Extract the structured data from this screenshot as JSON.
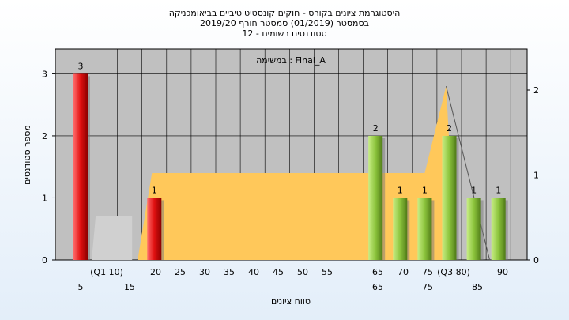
{
  "chart_data": {
    "type": "bar",
    "title": "היסטוגרמת ציונים בקורס - חוקים קונסטיטוטיביים בביאומכניקה",
    "subtitle_1": "בסמסטר (01/2019) סמסטר חורף 2019/20",
    "subtitle_2": "סטודנטים רשומים - 12",
    "inner_label": "במשימה : Final_A",
    "xlabel": "טווח ציונים",
    "ylabel": "מספר סטודנטים",
    "ylim": [
      0,
      3.4
    ],
    "y_ticks": [
      "0",
      "1",
      "2",
      "3"
    ],
    "y2_ticks": [
      "0",
      "1",
      "2"
    ],
    "x_ticks_row1": [
      "(Q1 10)",
      "20",
      "25",
      "30",
      "35",
      "40",
      "45",
      "50",
      "55",
      "65",
      "70",
      "75",
      "(Q3 80)",
      "90"
    ],
    "x_ticks_row2": [
      "5",
      "15",
      "65",
      "75",
      "85"
    ],
    "bars": [
      {
        "x": 5,
        "value": 3,
        "label": "3",
        "color": "#e02020"
      },
      {
        "x": 20,
        "value": 1,
        "label": "1",
        "color": "#e02020"
      },
      {
        "x": 65,
        "value": 2,
        "label": "2",
        "color": "#8cc43c"
      },
      {
        "x": 70,
        "value": 1,
        "label": "1",
        "color": "#8cc43c"
      },
      {
        "x": 75,
        "value": 1,
        "label": "1",
        "color": "#8cc43c"
      },
      {
        "x": 80,
        "value": 2,
        "label": "2",
        "color": "#8cc43c"
      },
      {
        "x": 85,
        "value": 1,
        "label": "1",
        "color": "#8cc43c"
      },
      {
        "x": 90,
        "value": 1,
        "label": "1",
        "color": "#8cc43c"
      }
    ],
    "colors": {
      "plot_bg": "#c0c0c0",
      "area_fill": "#ffc85a",
      "grey_box": "#d0d0d0",
      "fail": "#e02020",
      "pass": "#8cc43c"
    }
  }
}
